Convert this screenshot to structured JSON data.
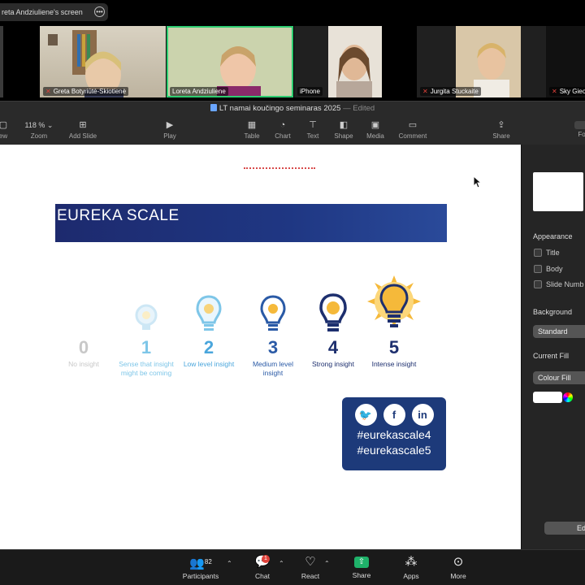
{
  "share_banner": {
    "label": "reta Andziuliene's screen"
  },
  "participants_strip": [
    {
      "name": "Greta Botyriūtė-Skiotienė",
      "muted": true,
      "active": false
    },
    {
      "name": "Loreta Andziuliene",
      "muted": false,
      "active": true
    },
    {
      "name": "iPhone",
      "muted": false,
      "active": false
    },
    {
      "name": "Jurgita Stuckaite",
      "muted": true,
      "active": false
    },
    {
      "name": "Sky Gieo",
      "muted": true,
      "active": false
    }
  ],
  "keynote": {
    "doc_title": "LT namai koučingo seminaras 2025",
    "edited": "— Edited",
    "zoom_value": "118 %",
    "toolbar": [
      {
        "label": "ew",
        "icon": "view-icon"
      },
      {
        "label": "Zoom",
        "icon": "zoom-icon"
      },
      {
        "label": "Add Slide",
        "icon": "add-slide-icon"
      },
      {
        "label": "Play",
        "icon": "play-icon"
      },
      {
        "label": "Table",
        "icon": "table-icon"
      },
      {
        "label": "Chart",
        "icon": "chart-icon"
      },
      {
        "label": "Text",
        "icon": "text-icon"
      },
      {
        "label": "Shape",
        "icon": "shape-icon"
      },
      {
        "label": "Media",
        "icon": "media-icon"
      },
      {
        "label": "Comment",
        "icon": "comment-icon"
      },
      {
        "label": "Share",
        "icon": "share-icon"
      },
      {
        "label": "Fo",
        "icon": "format-icon"
      }
    ]
  },
  "slide": {
    "title": "EUREKA SCALE",
    "scale": [
      {
        "num": "0",
        "desc": "No insight",
        "color": "#c8c8c8"
      },
      {
        "num": "1",
        "desc": "Sense that insight might be coming",
        "color": "#7ec6e8"
      },
      {
        "num": "2",
        "desc": "Low level insight",
        "color": "#4aa6dc"
      },
      {
        "num": "3",
        "desc": "Medium level insight",
        "color": "#2a5aa6"
      },
      {
        "num": "4",
        "desc": "Strong insight",
        "color": "#1d2f6e"
      },
      {
        "num": "5",
        "desc": "Intense insight",
        "color": "#1d2f6e"
      }
    ],
    "social": {
      "icons": [
        "t",
        "f",
        "in"
      ],
      "tags": [
        "#eurekascale4",
        "#eurekascale5"
      ]
    }
  },
  "inspector": {
    "appearance": "Appearance",
    "checks": [
      "Title",
      "Body",
      "Slide Numb"
    ],
    "background": "Background",
    "background_value": "Standard",
    "current_fill": "Current Fill",
    "fill_value": "Colour Fill",
    "edit": "Ed"
  },
  "zoom_toolbar": {
    "participants_count": "82",
    "participants": "Participants",
    "chat": "Chat",
    "chat_badge": "1",
    "react": "React",
    "share": "Share",
    "apps": "Apps",
    "more": "More"
  }
}
